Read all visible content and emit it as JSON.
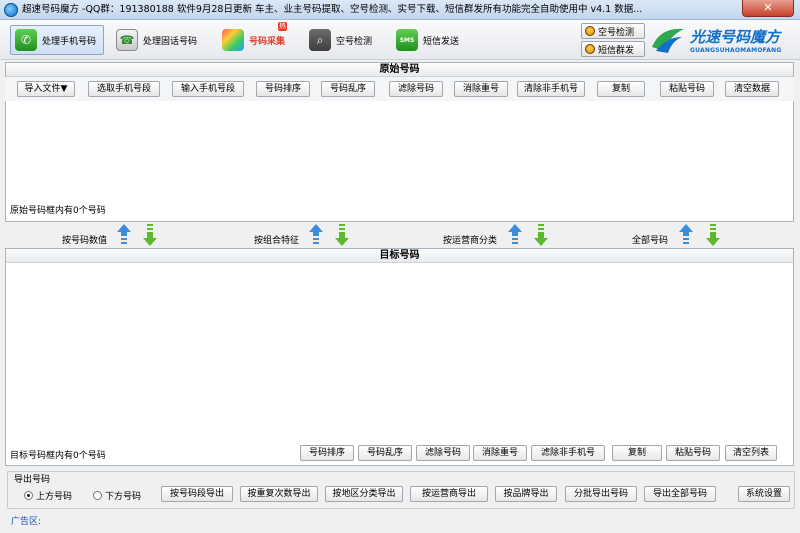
{
  "window": {
    "title": "超速号码魔方 -QQ群：191380188 软件9月28日更新 车主、业主号码提取、空号检测、实号下载、短信群发所有功能完全自助使用中  v4.1 数据...",
    "close_glyph": "✕"
  },
  "toolbar": {
    "items": [
      {
        "label": "处理手机号码",
        "icon": "phone-icon"
      },
      {
        "label": "处理固话号码",
        "icon": "telephone-icon"
      },
      {
        "label": "号码采集",
        "icon": "box-icon",
        "badge": "热"
      },
      {
        "label": "空号检测",
        "icon": "magnifier-icon"
      },
      {
        "label": "短信发送",
        "icon": "sms-icon",
        "icon_text": "SMS"
      }
    ],
    "side_buttons": [
      {
        "label": "空号检测",
        "icon": "qq-icon"
      },
      {
        "label": "短信群发",
        "icon": "qq-icon"
      }
    ],
    "brand": {
      "name": "光速号码魔方",
      "subtitle": "GUANGSUHAOMAMOFANG"
    }
  },
  "source": {
    "title": "原始号码",
    "buttons": [
      "导入文件▼",
      "选取手机号段",
      "输入手机号段",
      "号码排序",
      "号码乱序",
      "滤除号码",
      "消除重号",
      "清除非手机号",
      "复制",
      "粘贴号码",
      "清空数据"
    ],
    "content": "",
    "count_text": "原始号码框内有0个号码"
  },
  "move_bar": {
    "groups": [
      {
        "label": "按号码数值"
      },
      {
        "label": "按组合特征"
      },
      {
        "label": "按运营商分类"
      },
      {
        "label": "全部号码"
      }
    ]
  },
  "target": {
    "title": "目标号码",
    "content": "",
    "count_text": "目标号码框内有0个号码",
    "buttons": [
      "号码排序",
      "号码乱序",
      "滤除号码",
      "消除重号",
      "滤除非手机号",
      "复制",
      "粘贴号码",
      "清空列表"
    ]
  },
  "export": {
    "group_label": "导出号码",
    "radio_options": [
      {
        "label": "上方号码",
        "selected": true
      },
      {
        "label": "下方号码",
        "selected": false
      }
    ],
    "buttons": [
      "按号码段导出",
      "按重复次数导出",
      "按地区分类导出",
      "按运营商导出",
      "按品牌导出",
      "分批导出号码",
      "导出全部号码"
    ],
    "settings_label": "系统设置"
  },
  "ad": {
    "label": "广告区:"
  },
  "colors": {
    "accent_blue": "#1270c9",
    "ad_text": "#1e4fb5",
    "arrow_up": "#3a8fdc",
    "arrow_down": "#5cb82c",
    "hot_red": "#e03a2a"
  }
}
